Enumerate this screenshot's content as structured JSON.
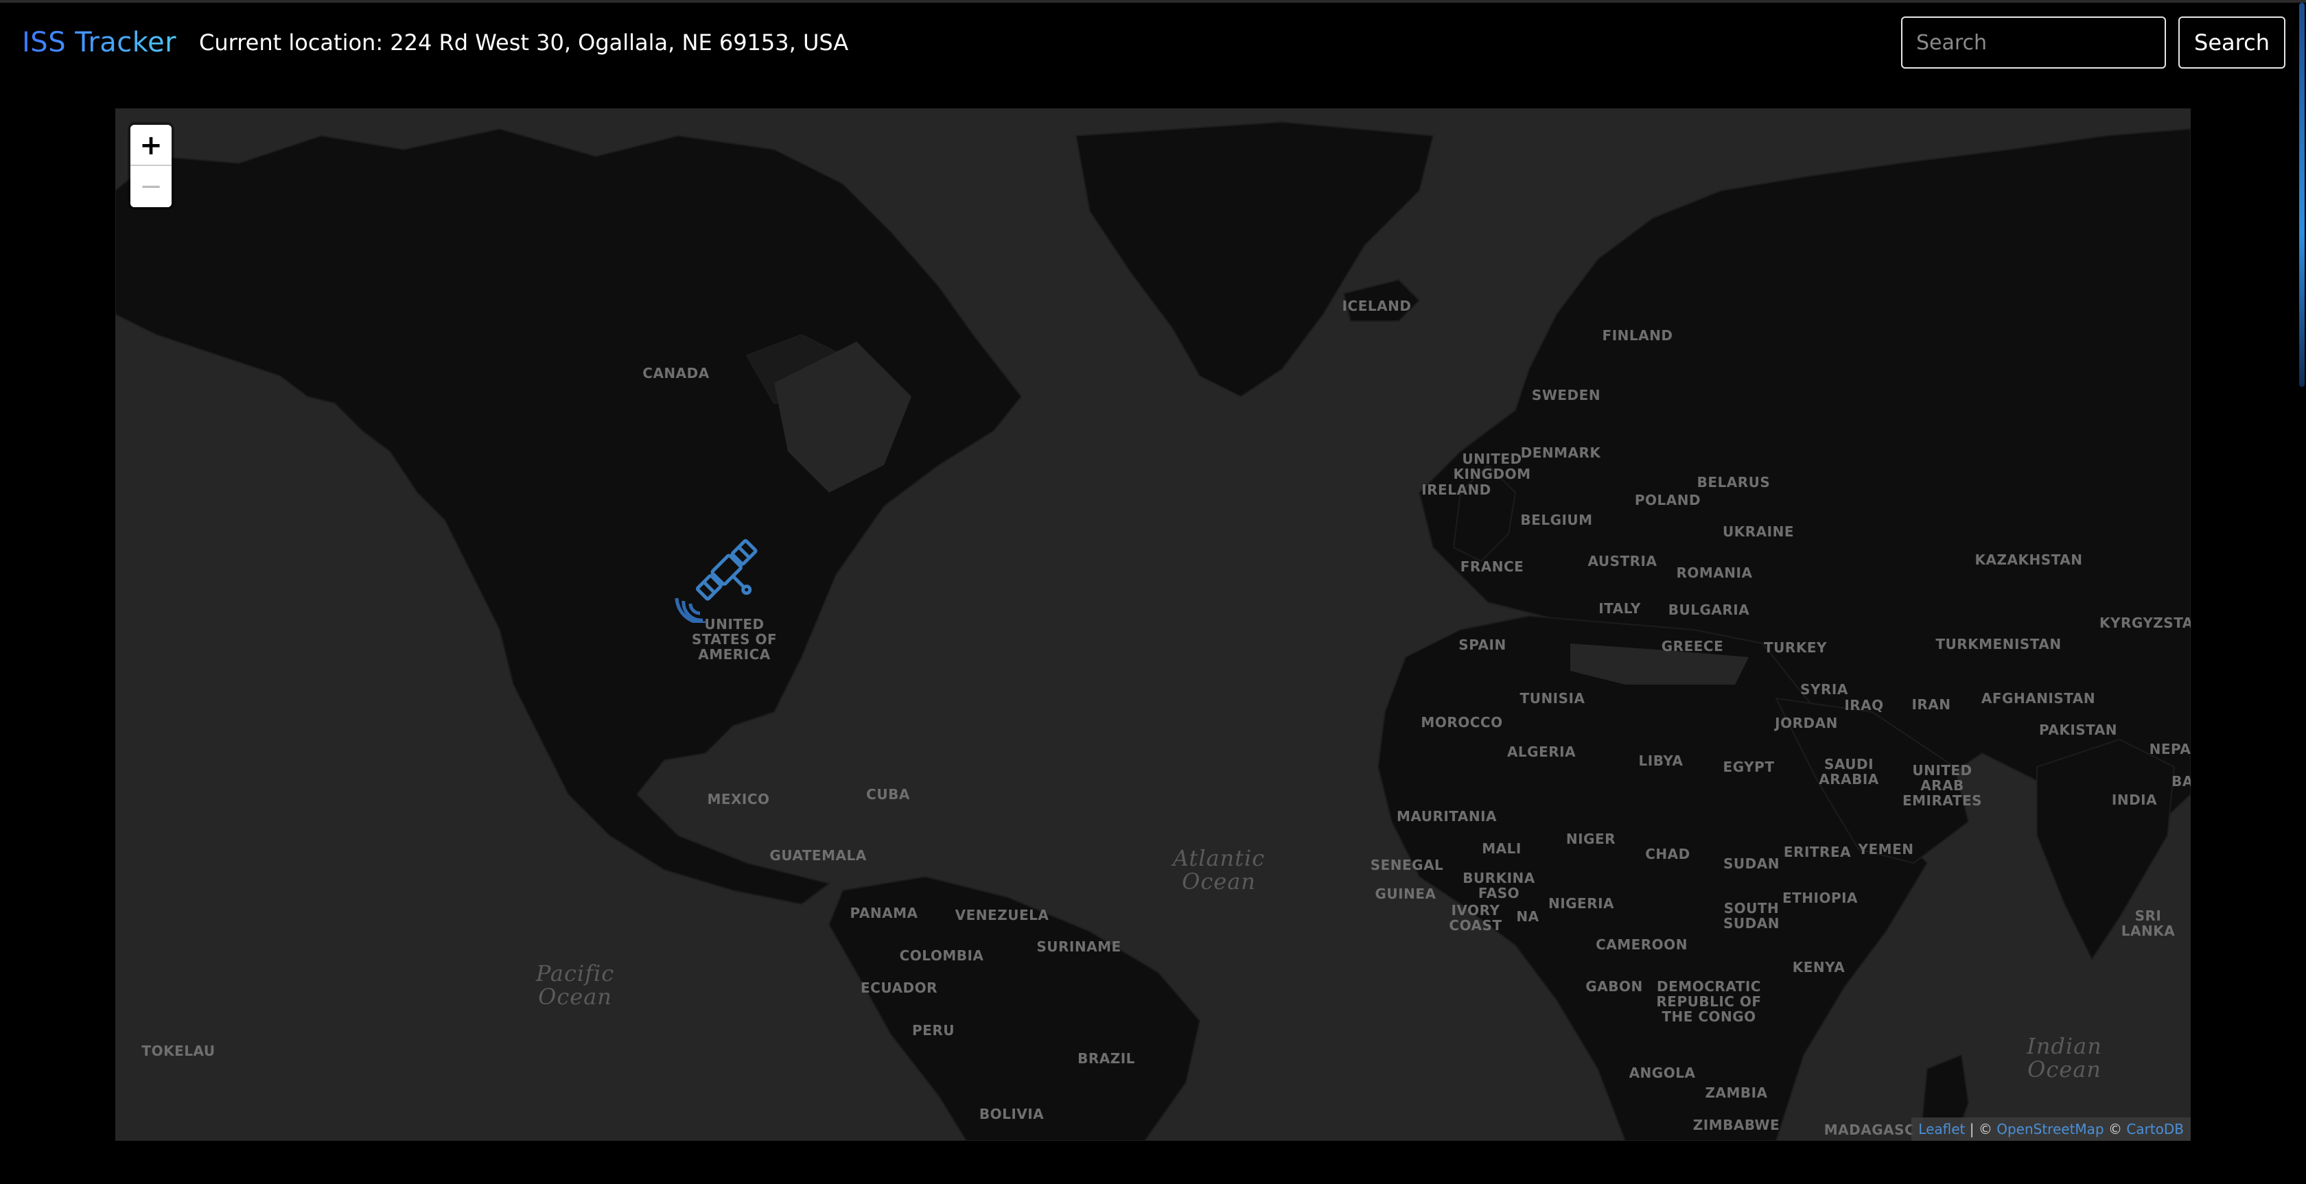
{
  "header": {
    "brand": "ISS Tracker",
    "location_text": "Current location: 224 Rd West 30, Ogallala, NE 69153, USA",
    "search_placeholder": "Search",
    "search_button_label": "Search"
  },
  "map": {
    "zoom_in_label": "+",
    "zoom_out_label": "−",
    "marker_icon": "satellite-icon",
    "colors": {
      "ocean": "#262626",
      "land": "#0e0e0e",
      "labels": "#6f6f6f",
      "marker": "#3a7fc4"
    },
    "attribution": {
      "leaflet": "Leaflet",
      "sep": " | © ",
      "osm": "OpenStreetMap",
      "sep2": " © ",
      "carto": "CartoDB"
    },
    "country_labels": [
      "CANADA",
      "UNITED\nSTATES OF\nAMERICA",
      "MEXICO",
      "CUBA",
      "GUATEMALA",
      "PANAMA",
      "VENEZUELA",
      "SURINAME",
      "COLOMBIA",
      "ECUADOR",
      "PERU",
      "BRAZIL",
      "BOLIVIA",
      "ICELAND",
      "FINLAND",
      "SWEDEN",
      "UNITED\nKINGDOM",
      "IRELAND",
      "DENMARK",
      "BELARUS",
      "POLAND",
      "BELGIUM",
      "UKRAINE",
      "FRANCE",
      "AUSTRIA",
      "ROMANIA",
      "BULGARIA",
      "ITALY",
      "SPAIN",
      "GREECE",
      "TURKEY",
      "KAZAKHSTAN",
      "KYRGYZSTAN",
      "TURKMENISTAN",
      "TUNISIA",
      "SYRIA",
      "IRAQ",
      "IRAN",
      "AFGHANISTAN",
      "PAKISTAN",
      "MOROCCO",
      "ALGERIA",
      "LIBYA",
      "EGYPT",
      "JORDAN",
      "SAUDI\nARABIA",
      "UNITED\nARAB\nEMIRATES",
      "NEPA",
      "INDIA",
      "BA",
      "MAURITANIA",
      "MALI",
      "NIGER",
      "CHAD",
      "SUDAN",
      "ERITREA",
      "YEMEN",
      "SENEGAL",
      "GUINEA",
      "BURKINA\nFASO",
      "IVORY\nCOAST",
      "NA",
      "NIGERIA",
      "ETHIOPIA",
      "SOUTH\nSUDAN",
      "CAMEROON",
      "GABON",
      "DEMOCRATIC\nREPUBLIC OF\nTHE CONGO",
      "KENYA",
      "ANGOLA",
      "ZAMBIA",
      "ZIMBABWE",
      "MADAGASC",
      "SRI LANKA",
      "TOKELAU"
    ],
    "ocean_labels": [
      "Atlantic\nOcean",
      "Pacific\nOcean",
      "Indian\nOcean"
    ]
  }
}
